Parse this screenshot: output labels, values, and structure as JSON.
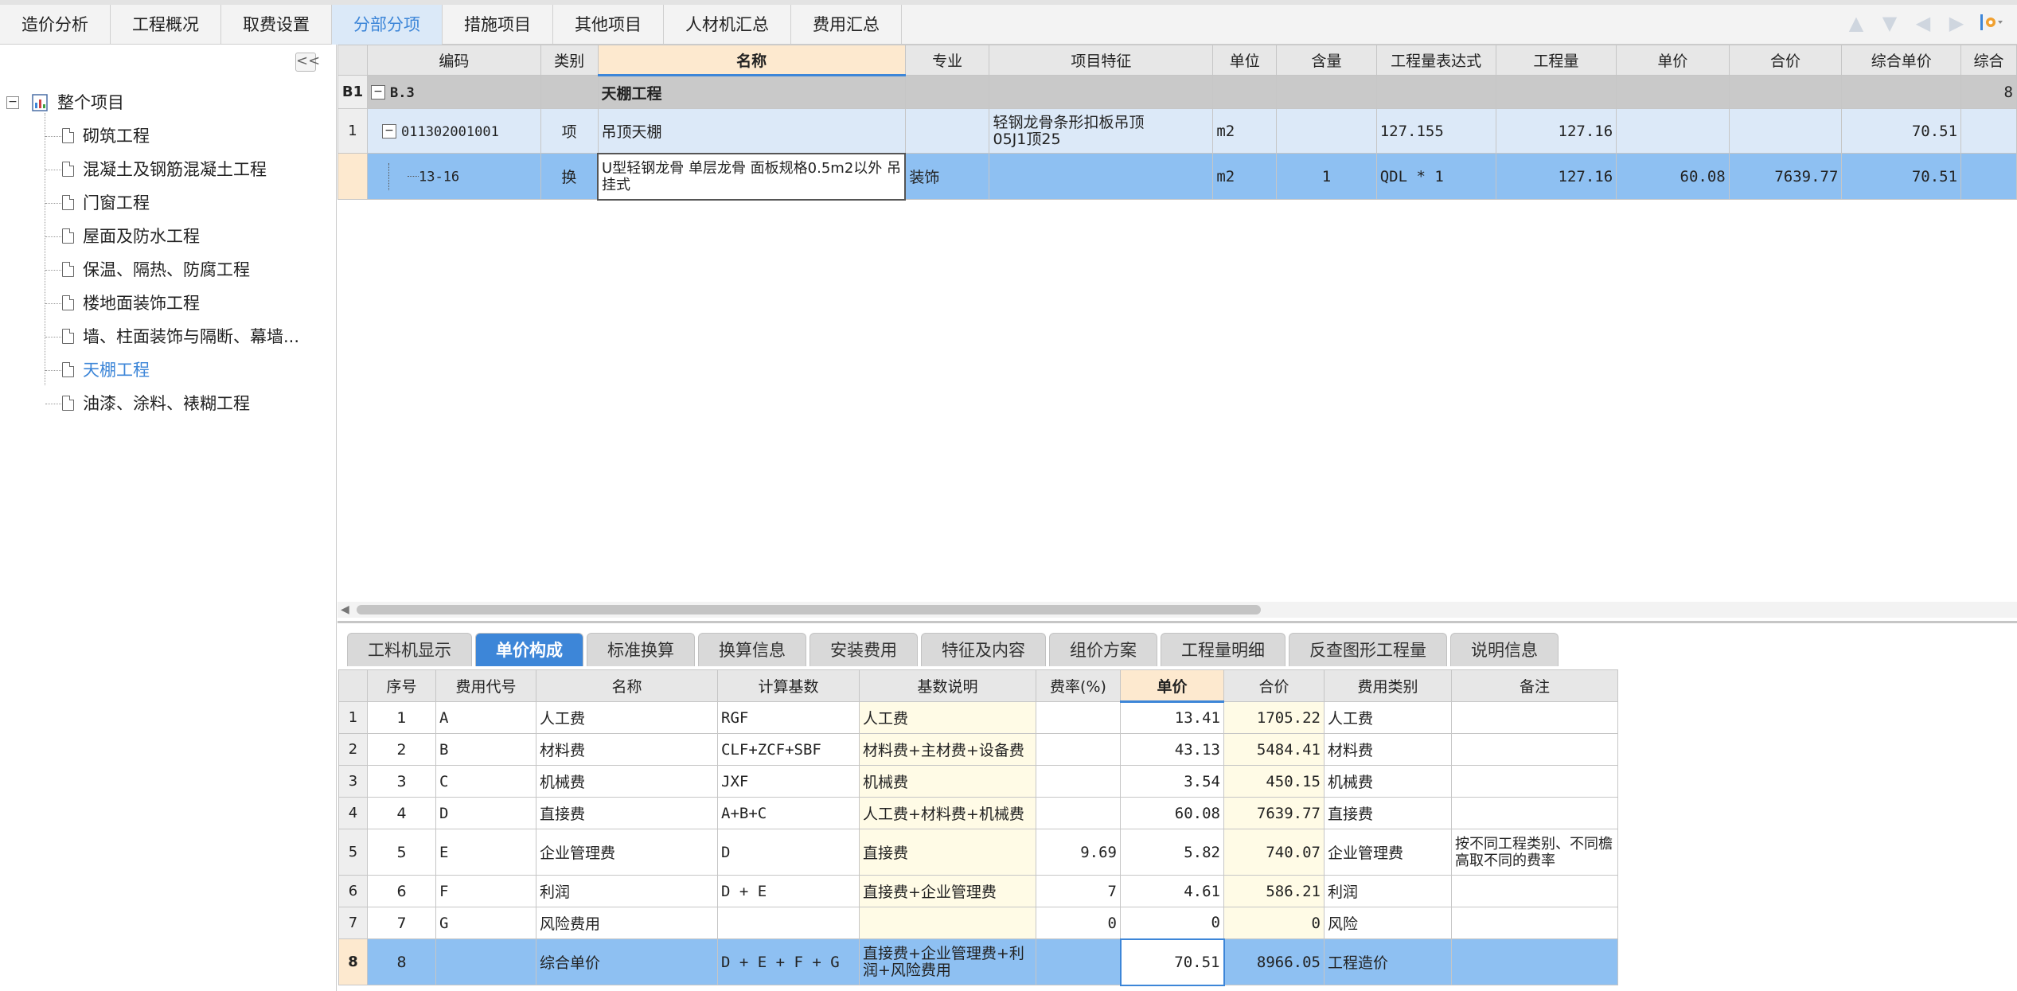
{
  "top_tabs": [
    "造价分析",
    "工程概况",
    "取费设置",
    "分部分项",
    "措施项目",
    "其他项目",
    "人材机汇总",
    "费用汇总"
  ],
  "active_top_tab": "分部分项",
  "tree": {
    "root": "整个项目",
    "root_expander": "−",
    "selected": "天棚工程",
    "items": [
      "砌筑工程",
      "混凝土及钢筋混凝土工程",
      "门窗工程",
      "屋面及防水工程",
      "保温、隔热、防腐工程",
      "楼地面装饰工程",
      "墙、柱面装饰与隔断、幕墙...",
      "天棚工程",
      "油漆、涂料、裱糊工程"
    ]
  },
  "collapse_label": "<<",
  "grid": {
    "columns": [
      "编码",
      "类别",
      "名称",
      "专业",
      "项目特征",
      "单位",
      "含量",
      "工程量表达式",
      "工程量",
      "单价",
      "合价",
      "综合单价",
      "综合"
    ],
    "rows": [
      {
        "rownum": "B1",
        "expander": "−",
        "code": "B.3",
        "type": "",
        "name": "天棚工程",
        "major": "",
        "feature": "",
        "unit": "",
        "qty_ratio": "",
        "expr": "",
        "quantity": "",
        "price": "",
        "total": "",
        "comp_price": "",
        "comp_total": "8"
      },
      {
        "rownum": "1",
        "expander": "−",
        "code": "011302001001",
        "type": "项",
        "name": "吊顶天棚",
        "major": "",
        "feature": "轻钢龙骨条形扣板吊顶\n05J1顶25",
        "unit": "m2",
        "qty_ratio": "",
        "expr": "127.155",
        "quantity": "127.16",
        "price": "",
        "total": "",
        "comp_price": "70.51",
        "comp_total": ""
      },
      {
        "rownum": "",
        "expander": "",
        "code": "13-16",
        "type": "换",
        "name": "U型轻钢龙骨 单层龙骨 面板规格0.5m2以外 吊挂式",
        "major": "装饰",
        "feature": "",
        "unit": "m2",
        "qty_ratio": "1",
        "expr": "QDL * 1",
        "quantity": "127.16",
        "price": "60.08",
        "total": "7639.77",
        "comp_price": "70.51",
        "comp_total": ""
      }
    ]
  },
  "bottom_tabs": [
    "工料机显示",
    "单价构成",
    "标准换算",
    "换算信息",
    "安装费用",
    "特征及内容",
    "组价方案",
    "工程量明细",
    "反查图形工程量",
    "说明信息"
  ],
  "active_bottom_tab": "单价构成",
  "price_table": {
    "columns": [
      "序号",
      "费用代号",
      "名称",
      "计算基数",
      "基数说明",
      "费率(%)",
      "单价",
      "合价",
      "费用类别",
      "备注"
    ],
    "rows": [
      {
        "rownum": "1",
        "seq": "1",
        "code": "A",
        "name": "人工费",
        "base": "RGF",
        "base_desc": "人工费",
        "rate": "",
        "price": "13.41",
        "total": "1705.22",
        "category": "人工费",
        "note": ""
      },
      {
        "rownum": "2",
        "seq": "2",
        "code": "B",
        "name": "材料费",
        "base": "CLF+ZCF+SBF",
        "base_desc": "材料费+主材费+设备费",
        "rate": "",
        "price": "43.13",
        "total": "5484.41",
        "category": "材料费",
        "note": ""
      },
      {
        "rownum": "3",
        "seq": "3",
        "code": "C",
        "name": "机械费",
        "base": "JXF",
        "base_desc": "机械费",
        "rate": "",
        "price": "3.54",
        "total": "450.15",
        "category": "机械费",
        "note": ""
      },
      {
        "rownum": "4",
        "seq": "4",
        "code": "D",
        "name": "直接费",
        "base": "A+B+C",
        "base_desc": "人工费+材料费+机械费",
        "rate": "",
        "price": "60.08",
        "total": "7639.77",
        "category": "直接费",
        "note": ""
      },
      {
        "rownum": "5",
        "seq": "5",
        "code": "E",
        "name": "企业管理费",
        "base": "D",
        "base_desc": "直接费",
        "rate": "9.69",
        "price": "5.82",
        "total": "740.07",
        "category": "企业管理费",
        "note": "按不同工程类别、不同檐高取不同的费率"
      },
      {
        "rownum": "6",
        "seq": "6",
        "code": "F",
        "name": "利润",
        "base": "D + E",
        "base_desc": "直接费+企业管理费",
        "rate": "7",
        "price": "4.61",
        "total": "586.21",
        "category": "利润",
        "note": ""
      },
      {
        "rownum": "7",
        "seq": "7",
        "code": "G",
        "name": "风险费用",
        "base": "",
        "base_desc": "",
        "rate": "0",
        "price": "0",
        "total": "0",
        "category": "风险",
        "note": ""
      },
      {
        "rownum": "8",
        "seq": "8",
        "code": "",
        "name": "综合单价",
        "base": "D + E + F + G",
        "base_desc": "直接费+企业管理费+利润+风险费用",
        "rate": "",
        "price": "70.51",
        "total": "8966.05",
        "category": "工程造价",
        "note": ""
      }
    ]
  },
  "colors": {
    "accent": "#3d86d8",
    "selected_row": "#8ec0f2",
    "light_row": "#dce9f8",
    "header_highlight": "#fde9cf",
    "group_row": "#c9c9c9",
    "cream": "#fffbe6"
  },
  "icons": {
    "nav": [
      "arrow-up-icon",
      "arrow-down-icon",
      "arrow-left-icon",
      "arrow-right-icon",
      "settings-icon"
    ]
  }
}
